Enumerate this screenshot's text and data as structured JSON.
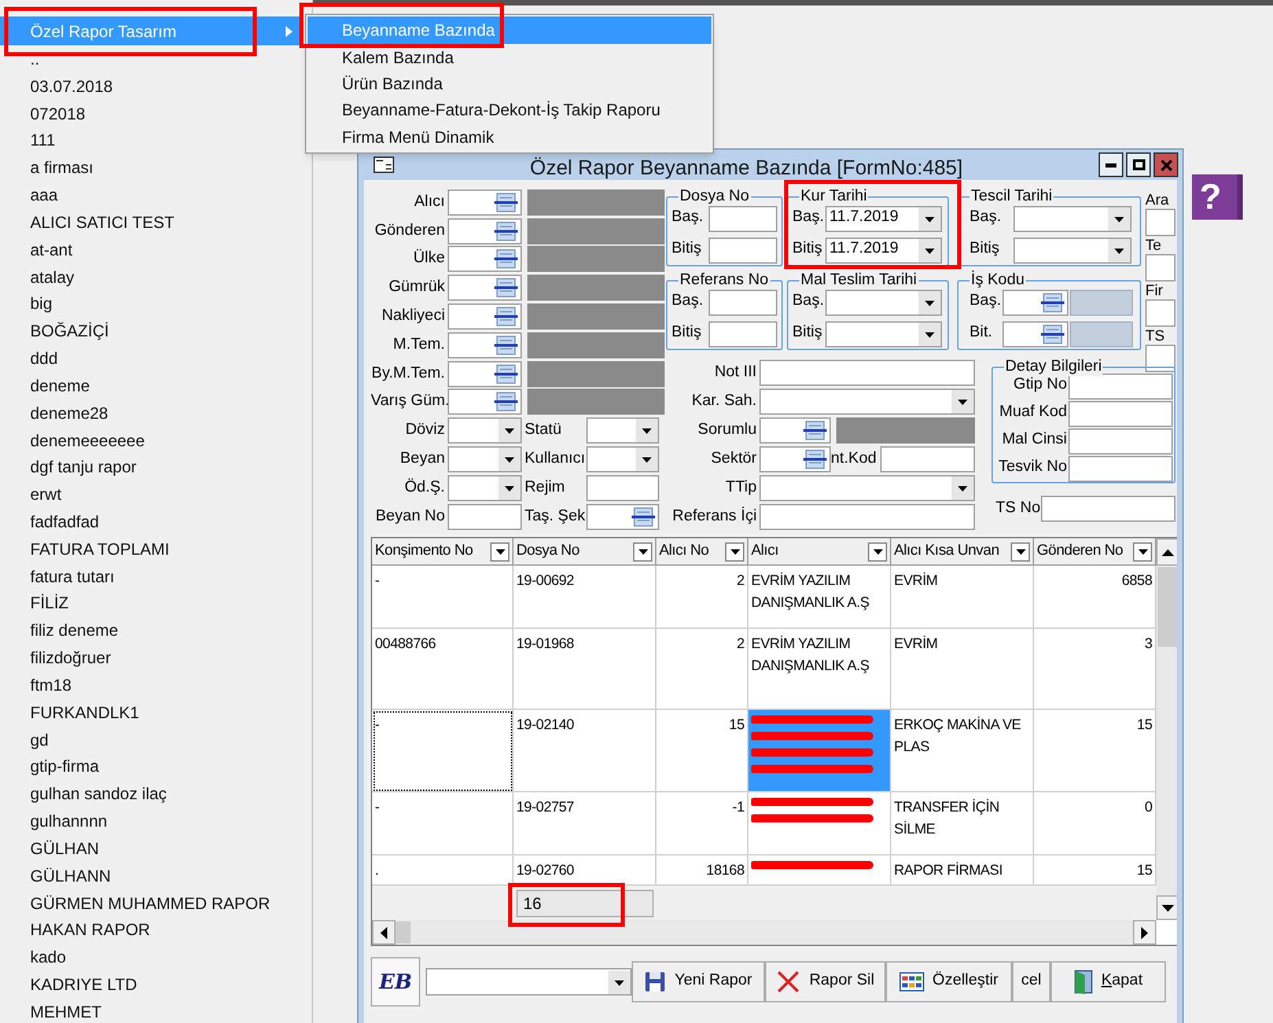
{
  "popup_menu": {
    "items": [
      {
        "label": "Özel Rapor Tasarım",
        "selected": true,
        "has_submenu": true,
        "highlighted": true
      },
      {
        "label": "..",
        "selected": false,
        "has_submenu": false,
        "highlighted": false
      },
      {
        "label": "03.07.2018",
        "selected": false,
        "has_submenu": false,
        "highlighted": false
      },
      {
        "label": "072018",
        "selected": false,
        "has_submenu": false,
        "highlighted": false
      },
      {
        "label": "111",
        "selected": false,
        "has_submenu": false,
        "highlighted": false
      },
      {
        "label": "a firması",
        "selected": false,
        "has_submenu": false,
        "highlighted": false
      },
      {
        "label": "aaa",
        "selected": false,
        "has_submenu": false,
        "highlighted": false
      },
      {
        "label": "ALICI SATICI TEST",
        "selected": false,
        "has_submenu": false,
        "highlighted": false
      },
      {
        "label": "at-ant",
        "selected": false,
        "has_submenu": false,
        "highlighted": false
      },
      {
        "label": "atalay",
        "selected": false,
        "has_submenu": false,
        "highlighted": false
      },
      {
        "label": "big",
        "selected": false,
        "has_submenu": false,
        "highlighted": false
      },
      {
        "label": "BOĞAZİÇİ",
        "selected": false,
        "has_submenu": false,
        "highlighted": false
      },
      {
        "label": "ddd",
        "selected": false,
        "has_submenu": false,
        "highlighted": false
      },
      {
        "label": "deneme",
        "selected": false,
        "has_submenu": false,
        "highlighted": false
      },
      {
        "label": "deneme28",
        "selected": false,
        "has_submenu": false,
        "highlighted": false
      },
      {
        "label": "denemeeeeeee",
        "selected": false,
        "has_submenu": false,
        "highlighted": false
      },
      {
        "label": "dgf tanju rapor",
        "selected": false,
        "has_submenu": false,
        "highlighted": false
      },
      {
        "label": "erwt",
        "selected": false,
        "has_submenu": false,
        "highlighted": false
      },
      {
        "label": "fadfadfad",
        "selected": false,
        "has_submenu": false,
        "highlighted": false
      },
      {
        "label": "FATURA TOPLAMI",
        "selected": false,
        "has_submenu": false,
        "highlighted": false
      },
      {
        "label": "fatura tutarı",
        "selected": false,
        "has_submenu": false,
        "highlighted": false
      },
      {
        "label": "FİLİZ",
        "selected": false,
        "has_submenu": false,
        "highlighted": false
      },
      {
        "label": "filiz deneme",
        "selected": false,
        "has_submenu": false,
        "highlighted": false
      },
      {
        "label": "filizdoğruer",
        "selected": false,
        "has_submenu": false,
        "highlighted": false
      },
      {
        "label": "ftm18",
        "selected": false,
        "has_submenu": false,
        "highlighted": false
      },
      {
        "label": "FURKANDLK1",
        "selected": false,
        "has_submenu": false,
        "highlighted": false
      },
      {
        "label": "gd",
        "selected": false,
        "has_submenu": false,
        "highlighted": false
      },
      {
        "label": "gtip-firma",
        "selected": false,
        "has_submenu": false,
        "highlighted": false
      },
      {
        "label": "gulhan sandoz ilaç",
        "selected": false,
        "has_submenu": false,
        "highlighted": false
      },
      {
        "label": "gulhannnn",
        "selected": false,
        "has_submenu": false,
        "highlighted": false
      },
      {
        "label": "GÜLHAN",
        "selected": false,
        "has_submenu": false,
        "highlighted": false
      },
      {
        "label": "GÜLHANN",
        "selected": false,
        "has_submenu": false,
        "highlighted": false
      },
      {
        "label": "GÜRMEN MUHAMMED RAPOR",
        "selected": false,
        "has_submenu": false,
        "highlighted": false
      },
      {
        "label": "HAKAN RAPOR",
        "selected": false,
        "has_submenu": false,
        "highlighted": false
      },
      {
        "label": "kado",
        "selected": false,
        "has_submenu": false,
        "highlighted": false
      },
      {
        "label": "KADRIYE LTD",
        "selected": false,
        "has_submenu": false,
        "highlighted": false
      },
      {
        "label": "MEHMET",
        "selected": false,
        "has_submenu": false,
        "highlighted": false
      }
    ]
  },
  "submenu": {
    "items": [
      {
        "label": "Beyanname Bazında",
        "selected": true,
        "highlighted": true
      },
      {
        "label": "Kalem Bazında",
        "selected": false,
        "highlighted": false
      },
      {
        "label": "Ürün Bazında",
        "selected": false,
        "highlighted": false
      },
      {
        "label": "Beyanname-Fatura-Dekont-İş Takip Raporu",
        "selected": false,
        "highlighted": false
      },
      {
        "label": "Firma Menü Dinamik",
        "selected": false,
        "highlighted": false
      }
    ]
  },
  "window": {
    "title": "Özel Rapor Beyanname Bazında [FormNo:485]"
  },
  "help_button": {
    "label": "?"
  },
  "party_fields": [
    {
      "label": "Alıcı"
    },
    {
      "label": "Gönderen"
    },
    {
      "label": "Ülke"
    },
    {
      "label": "Gümrük"
    },
    {
      "label": "Nakliyeci"
    },
    {
      "label": "M.Tem."
    },
    {
      "label": "By.M.Tem."
    },
    {
      "label": "Varış Güm."
    }
  ],
  "option_rows": [
    {
      "fields": [
        {
          "label": "Döviz",
          "kind": "combo"
        },
        {
          "label": "Statü",
          "kind": "combo"
        }
      ]
    },
    {
      "fields": [
        {
          "label": "Beyan",
          "kind": "combo"
        },
        {
          "label": "Kullanıcı",
          "kind": "combo"
        }
      ]
    },
    {
      "fields": [
        {
          "label": "Öd.Ş.",
          "kind": "combo"
        },
        {
          "label": "Rejim",
          "kind": "input"
        }
      ]
    },
    {
      "fields": [
        {
          "label": "Beyan No",
          "kind": "input"
        },
        {
          "label": "Taş. Şek",
          "kind": "lookup"
        }
      ]
    }
  ],
  "group_columns": [
    [
      {
        "title": "Dosya No",
        "highlighted": false,
        "rows": [
          {
            "label": "Baş.",
            "kind": "input"
          },
          {
            "label": "Bitiş",
            "kind": "input"
          }
        ]
      },
      {
        "title": "Referans No",
        "highlighted": false,
        "rows": [
          {
            "label": "Baş.",
            "kind": "input"
          },
          {
            "label": "Bitiş",
            "kind": "input"
          }
        ]
      }
    ],
    [
      {
        "title": "Kur Tarihi",
        "highlighted": true,
        "rows": [
          {
            "label": "Baş.",
            "kind": "combo",
            "value": "11.7.2019"
          },
          {
            "label": "Bitiş",
            "kind": "combo",
            "value": "11.7.2019"
          }
        ]
      },
      {
        "title": "Mal Teslim Tarihi",
        "highlighted": false,
        "rows": [
          {
            "label": "Baş.",
            "kind": "combo"
          },
          {
            "label": "Bitiş",
            "kind": "combo"
          }
        ]
      }
    ],
    [
      {
        "title": "Tescil Tarihi",
        "highlighted": false,
        "rows": [
          {
            "label": "Baş.",
            "kind": "combo"
          },
          {
            "label": "Bitiş",
            "kind": "combo"
          }
        ]
      },
      {
        "title": "İş Kodu",
        "highlighted": false,
        "rows": [
          {
            "label": "Baş.",
            "kind": "lookup_code"
          },
          {
            "label": "Bit.",
            "kind": "lookup_code"
          }
        ]
      }
    ]
  ],
  "side_fields": [
    "Ara",
    "Te",
    "Fir",
    "TS"
  ],
  "filter_fields": [
    {
      "label": "Not III",
      "kind": "input"
    },
    {
      "label": "Kar. Sah.",
      "kind": "combo"
    },
    {
      "label": "Sorumlu",
      "kind": "lookup_name"
    },
    {
      "label": "Sektör",
      "kind": "lookup_extra",
      "extra_label": "nt.Kod"
    },
    {
      "label": "TTip",
      "kind": "combo"
    },
    {
      "label": "Referans İçi",
      "kind": "input"
    }
  ],
  "detail_group": {
    "title": "Detay Bilgileri",
    "fields": [
      "Gtip No",
      "Muaf Kod",
      "Mal Cinsi",
      "Tesvik No"
    ]
  },
  "ts_no": {
    "label": "TS No"
  },
  "grid": {
    "columns": [
      "Konşimento No",
      "Dosya No",
      "Alıcı No",
      "Alıcı",
      "Alıcı Kısa Unvan",
      "Gönderen No"
    ],
    "rows": [
      {
        "selected": false,
        "focused": false,
        "cells": [
          {
            "text": "-"
          },
          {
            "text": "19-00692"
          },
          {
            "text": "2"
          },
          {
            "text": "EVRİM YAZILIM DANIŞMANLIK A.Ş"
          },
          {
            "text": "EVRİM"
          },
          {
            "text": "6858"
          }
        ]
      },
      {
        "selected": false,
        "focused": false,
        "cells": [
          {
            "text": "00488766"
          },
          {
            "text": "19-01968"
          },
          {
            "text": "2"
          },
          {
            "text": "EVRİM YAZILIM DANIŞMANLIK A.Ş"
          },
          {
            "text": "EVRİM"
          },
          {
            "text": "3"
          }
        ]
      },
      {
        "selected": true,
        "focused": true,
        "cells": [
          {
            "text": "-"
          },
          {
            "text": "19-02140"
          },
          {
            "text": "15"
          },
          {
            "redacted": true
          },
          {
            "text": "ERKOÇ MAKİNA VE PLAS"
          },
          {
            "text": "15"
          }
        ]
      },
      {
        "selected": false,
        "focused": false,
        "cells": [
          {
            "text": "-"
          },
          {
            "text": "19-02757"
          },
          {
            "text": "-1"
          },
          {
            "redacted": true
          },
          {
            "text": "TRANSFER İÇİN SİLME"
          },
          {
            "text": "0"
          }
        ]
      },
      {
        "selected": false,
        "focused": false,
        "cells": [
          {
            "text": "."
          },
          {
            "text": "19-02760"
          },
          {
            "text": "18168"
          },
          {
            "redacted": true
          },
          {
            "text": "RAPOR FİRMASI"
          },
          {
            "text": "15"
          }
        ]
      }
    ],
    "count": "16",
    "count_highlighted": true
  },
  "toolbar": {
    "logo": "EB",
    "buttons": [
      {
        "label": "Yeni Rapor",
        "underline_first": false
      },
      {
        "label": "Rapor Sil",
        "underline_first": false
      },
      {
        "label": "Özelleştir",
        "underline_first": false
      },
      {
        "label": "cel",
        "underline_first": false
      },
      {
        "label": "Kapat",
        "underline_first": true
      }
    ]
  }
}
